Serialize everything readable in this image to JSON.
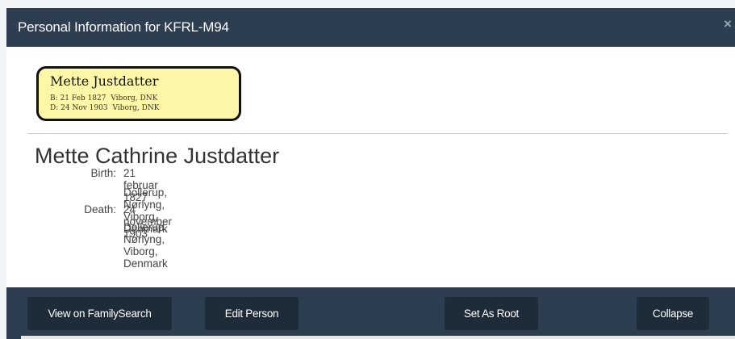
{
  "header": {
    "title": "Personal Information for KFRL-M94",
    "close_label": "×"
  },
  "card": {
    "name": "Mette Justdatter",
    "birth_prefix": "B:",
    "birth_date": "21 Feb 1827",
    "birth_place": "Viborg, DNK",
    "death_prefix": "D:",
    "death_date": "24 Nov 1903",
    "death_place": "Viborg, DNK",
    "background_color": "#fdf8a8"
  },
  "person": {
    "full_name": "Mette Cathrine Justdatter",
    "birth": {
      "label": "Birth:",
      "date": "21 februar 1827",
      "place": "Dollerup, Nørlyng, Viborg, Denmark"
    },
    "death": {
      "label": "Death:",
      "date": "24 november 1903",
      "place": "Dollerup, Nørlyng, Viborg, Denmark"
    }
  },
  "footer": {
    "view_on_familysearch": "View on FamilySearch",
    "edit_person": "Edit Person",
    "set_as_root": "Set As Root",
    "collapse": "Collapse"
  },
  "colors": {
    "header_bg": "#2c3e50",
    "button_bg": "#1e2b38"
  }
}
